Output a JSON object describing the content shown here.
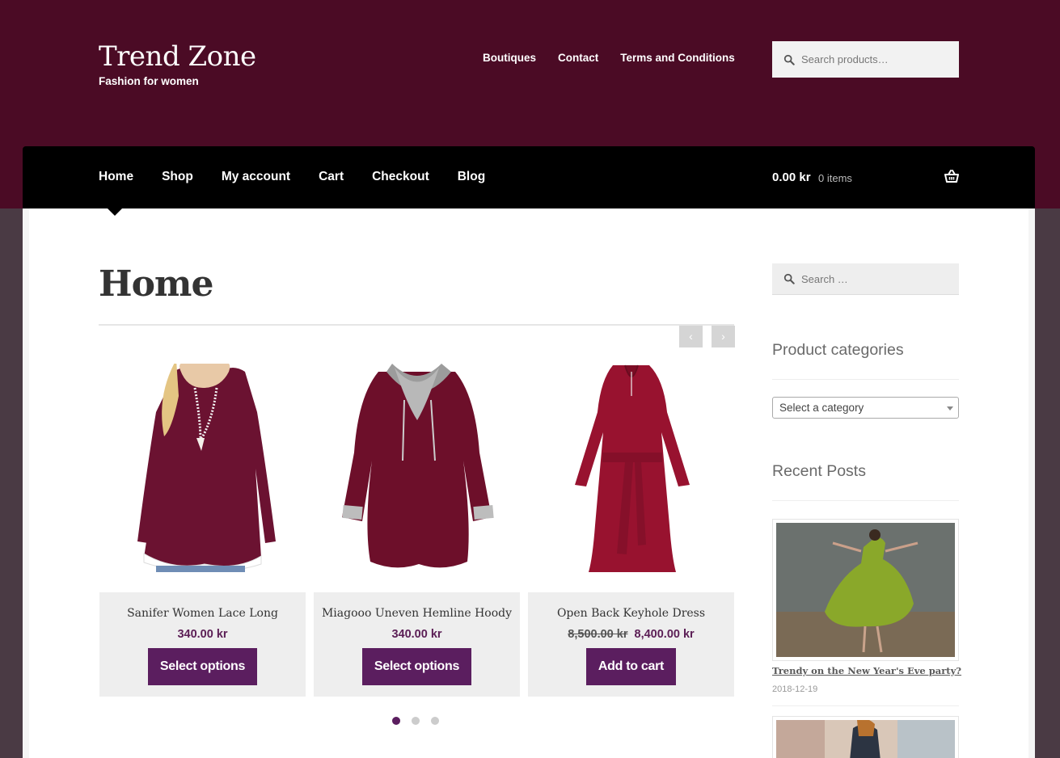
{
  "site": {
    "title": "Trend Zone",
    "tagline": "Fashion for women"
  },
  "top_nav": [
    "Boutiques",
    "Contact",
    "Terms and Conditions"
  ],
  "header_search": {
    "placeholder": "Search products…"
  },
  "main_nav": {
    "items": [
      "Home",
      "Shop",
      "My account",
      "Cart",
      "Checkout",
      "Blog"
    ],
    "active": "Home"
  },
  "cart": {
    "total": "0.00 kr",
    "count": "0 items"
  },
  "page": {
    "title": "Home"
  },
  "carousel": {
    "prev_icon": "‹",
    "next_icon": "›",
    "active_dot": 1,
    "dot_count": 3
  },
  "products": [
    {
      "name": "Sanifer Women Lace Long",
      "price": "340.00 kr",
      "old_price": "",
      "button": "Select options"
    },
    {
      "name": "Miagooo Uneven Hemline Hoody",
      "price": "340.00 kr",
      "old_price": "",
      "button": "Select options"
    },
    {
      "name": "Open Back Keyhole Dress",
      "price": "8,400.00 kr",
      "old_price": "8,500.00 kr",
      "button": "Add to cart"
    }
  ],
  "sidebar": {
    "search_placeholder": "Search …",
    "categories_title": "Product categories",
    "category_select": "Select a category",
    "recent_posts_title": "Recent Posts",
    "posts": [
      {
        "title": "Trendy on the New Year's Eve party?",
        "date": "2018-12-19"
      }
    ]
  },
  "colors": {
    "header_bg": "#4b0b25",
    "nav_bg": "#000000",
    "accent": "#5b1e5f"
  }
}
